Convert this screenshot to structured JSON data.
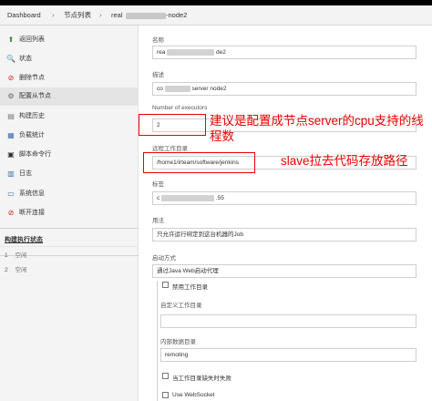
{
  "breadcrumb": {
    "items": [
      "Dashboard",
      "节点列表",
      "real",
      "-node2"
    ],
    "separator": "›"
  },
  "sidebar": {
    "items": [
      {
        "label": "返回列表",
        "icon": "up-arrow-icon",
        "color": "#3a8a3a"
      },
      {
        "label": "状态",
        "icon": "magnifier-icon",
        "color": "#555555"
      },
      {
        "label": "删除节点",
        "icon": "no-entry-icon",
        "color": "#cc2222"
      },
      {
        "label": "配置从节点",
        "icon": "gear-icon",
        "color": "#666666"
      },
      {
        "label": "构建历史",
        "icon": "notepad-icon",
        "color": "#777777"
      },
      {
        "label": "负载统计",
        "icon": "chart-icon",
        "color": "#3a6fb0"
      },
      {
        "label": "脚本命令行",
        "icon": "terminal-icon",
        "color": "#333333"
      },
      {
        "label": "日志",
        "icon": "document-icon",
        "color": "#3a6fb0"
      },
      {
        "label": "系统信息",
        "icon": "monitor-icon",
        "color": "#3a6fb0"
      },
      {
        "label": "断开连接",
        "icon": "no-entry-icon",
        "color": "#cc2222"
      }
    ],
    "executor_status": {
      "title": "构建执行状态",
      "rows": [
        {
          "num": "1",
          "state": "空闲"
        },
        {
          "num": "2",
          "state": "空闲"
        }
      ]
    }
  },
  "form": {
    "name": {
      "label": "名称",
      "prefix": "rea",
      "suffix": "de2"
    },
    "description": {
      "label": "描述",
      "prefix": "co",
      "suffix": "server node2"
    },
    "executors": {
      "label": "Number of executors",
      "value": "2"
    },
    "remote_root": {
      "label": "远程工作目录",
      "value": "/home1/irteam/software/jenkins"
    },
    "labels": {
      "label": "标签",
      "prefix": "c",
      "suffix": ".55"
    },
    "usage": {
      "label": "用法",
      "value": "只允许运行绑定到这台机器的Job"
    },
    "launch": {
      "label": "启动方式",
      "value": "通过Java Web启动代理"
    },
    "disable_workdir": {
      "label": "禁用工作目录"
    },
    "custom_workdir": {
      "label": "自定义工作目录",
      "value": ""
    },
    "internal_data_dir": {
      "label": "内部数据目录",
      "value": "remoting"
    },
    "fail_if_missing": {
      "label": "当工作目录缺失时失败"
    },
    "use_websocket": {
      "label": "Use WebSocket"
    }
  },
  "annotations": {
    "executors_note": "建议是配置成节点server的cpu支持的线程数",
    "workdir_note": "slave拉去代码存放路径",
    "color": "#ee0000"
  }
}
